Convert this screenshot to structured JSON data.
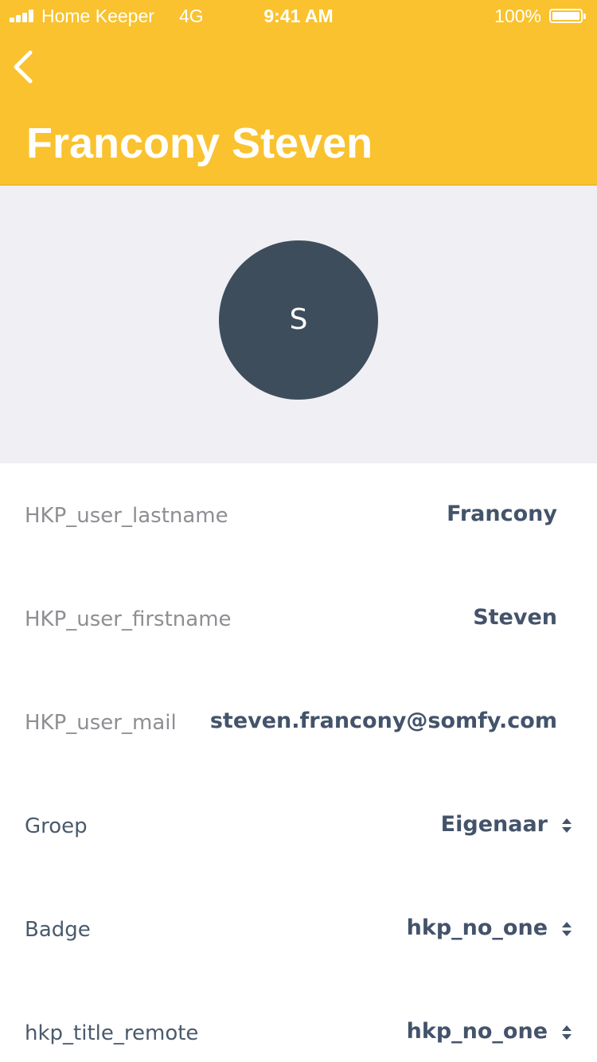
{
  "status_bar": {
    "carrier": "Home Keeper",
    "network": "4G",
    "time": "9:41 AM",
    "battery_percent": "100%"
  },
  "header": {
    "title": "Francony Steven",
    "back_icon": "chevron-left-icon",
    "background_color": "#F9C22E"
  },
  "profile": {
    "avatar_initial": "S",
    "avatar_color": "#3E4D5B"
  },
  "fields": [
    {
      "label": "HKP_user_lastname",
      "value": "Francony"
    },
    {
      "label": "HKP_user_firstname",
      "value": "Steven"
    },
    {
      "label": "HKP_user_mail",
      "value": "steven.francony@somfy.com"
    },
    {
      "label": "Groep",
      "value": "Eigenaar"
    },
    {
      "label": "Badge",
      "value": "hkp_no_one"
    },
    {
      "label": "hkp_title_remote",
      "value": "hkp_no_one"
    }
  ]
}
